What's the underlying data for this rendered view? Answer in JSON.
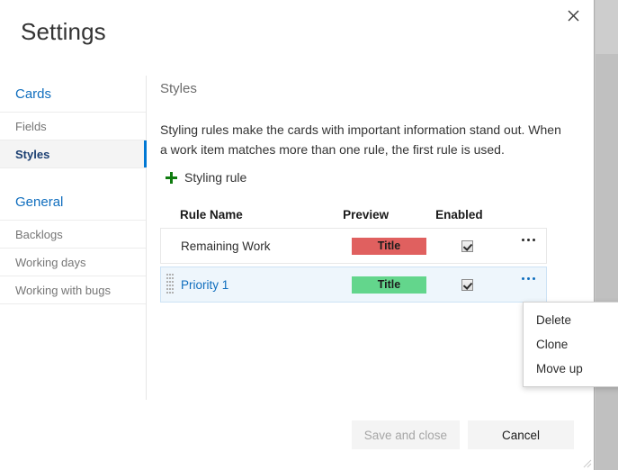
{
  "dialog": {
    "title": "Settings",
    "close_label": "Close"
  },
  "sidebar": {
    "groups": [
      {
        "header": "Cards",
        "items": [
          {
            "label": "Fields",
            "selected": false
          },
          {
            "label": "Styles",
            "selected": true
          }
        ]
      },
      {
        "header": "General",
        "items": [
          {
            "label": "Backlogs",
            "selected": false
          },
          {
            "label": "Working days",
            "selected": false
          },
          {
            "label": "Working with bugs",
            "selected": false
          }
        ]
      }
    ]
  },
  "content": {
    "heading": "Styles",
    "description": "Styling rules make the cards with important information stand out. When a work item matches more than one rule, the first rule is used.",
    "add_rule_label": "Styling rule",
    "table": {
      "columns": [
        "Rule Name",
        "Preview",
        "Enabled"
      ],
      "rows": [
        {
          "name": "Remaining Work",
          "preview_text": "Title",
          "preview_color": "#e0605f",
          "enabled": true,
          "selected": false
        },
        {
          "name": "Priority 1",
          "preview_text": "Title",
          "preview_color": "#63d68c",
          "enabled": true,
          "selected": true
        }
      ]
    }
  },
  "context_menu": {
    "items": [
      "Delete",
      "Clone",
      "Move up"
    ]
  },
  "footer": {
    "save_label": "Save and close",
    "cancel_label": "Cancel"
  },
  "colors": {
    "accent": "#0078d4",
    "link": "#106ebe",
    "plus_green": "#107c10",
    "selected_row_bg": "#eef6fc"
  }
}
